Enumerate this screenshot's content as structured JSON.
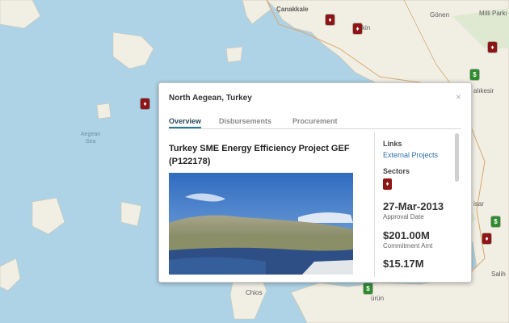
{
  "map": {
    "place_labels": [
      "Çanakkale",
      "Gönen",
      "Milli Parkı",
      "alıkesir",
      "isar",
      "Salih",
      "Chios",
      "ürün",
      "kin"
    ],
    "sea_label": [
      "Aegean",
      "Sea"
    ]
  },
  "popup": {
    "title": "North Aegean, Turkey",
    "close_label": "×",
    "tabs": [
      "Overview",
      "Disbursements",
      "Procurement"
    ],
    "project_title": "Turkey SME Energy Efficiency Project GEF (P122178)",
    "sidebar": {
      "links_heading": "Links",
      "external_projects": "External Projects",
      "sectors_heading": "Sectors",
      "sector_icon": "building-icon",
      "approval_date": "27-Mar-2013",
      "approval_label": "Approval Date",
      "commitment_amt": "$201.00M",
      "commitment_label": "Commitment Amt",
      "cut_value": "$15.17M"
    }
  }
}
